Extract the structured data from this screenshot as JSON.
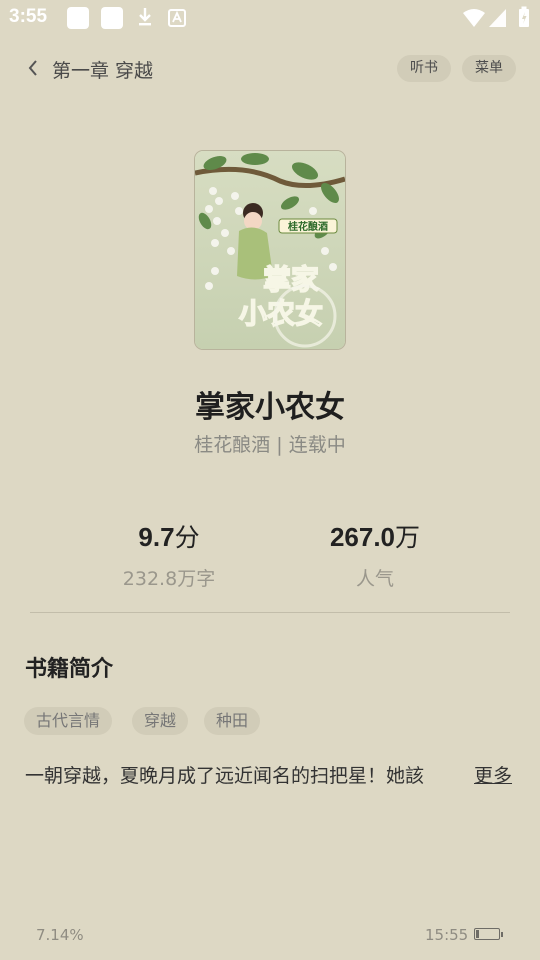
{
  "status_bar": {
    "time": "3:55",
    "icons": [
      "notification-box-icon",
      "notification-box-icon",
      "download-icon",
      "font-icon",
      "wifi-icon",
      "signal-icon",
      "battery-icon"
    ]
  },
  "header": {
    "chapter_title": "第一章 穿越",
    "listen_label": "听书",
    "menu_label": "菜单"
  },
  "book": {
    "cover_text_small": "桂花酿酒",
    "cover_text_big": "掌家小农女",
    "title": "掌家小农女",
    "meta": "桂花酿酒 | 连载中",
    "stats": [
      {
        "value": "9.7",
        "unit": "分",
        "label": "232.8万字"
      },
      {
        "value": "267.0",
        "unit": "万",
        "label": "人气"
      }
    ]
  },
  "intro": {
    "section_title": "书籍简介",
    "tags": [
      "古代言情",
      "穿越",
      "种田"
    ],
    "text": "一朝穿越，夏晚月成了远近闻名的扫把星！她該",
    "more_label": "更多"
  },
  "footer": {
    "progress": "7.14%",
    "time": "15:55",
    "battery_level": 0.15
  },
  "colors": {
    "background": "#ddd8c4",
    "pill": "#d1ccb8",
    "cover_green": "#2f6b2c"
  }
}
